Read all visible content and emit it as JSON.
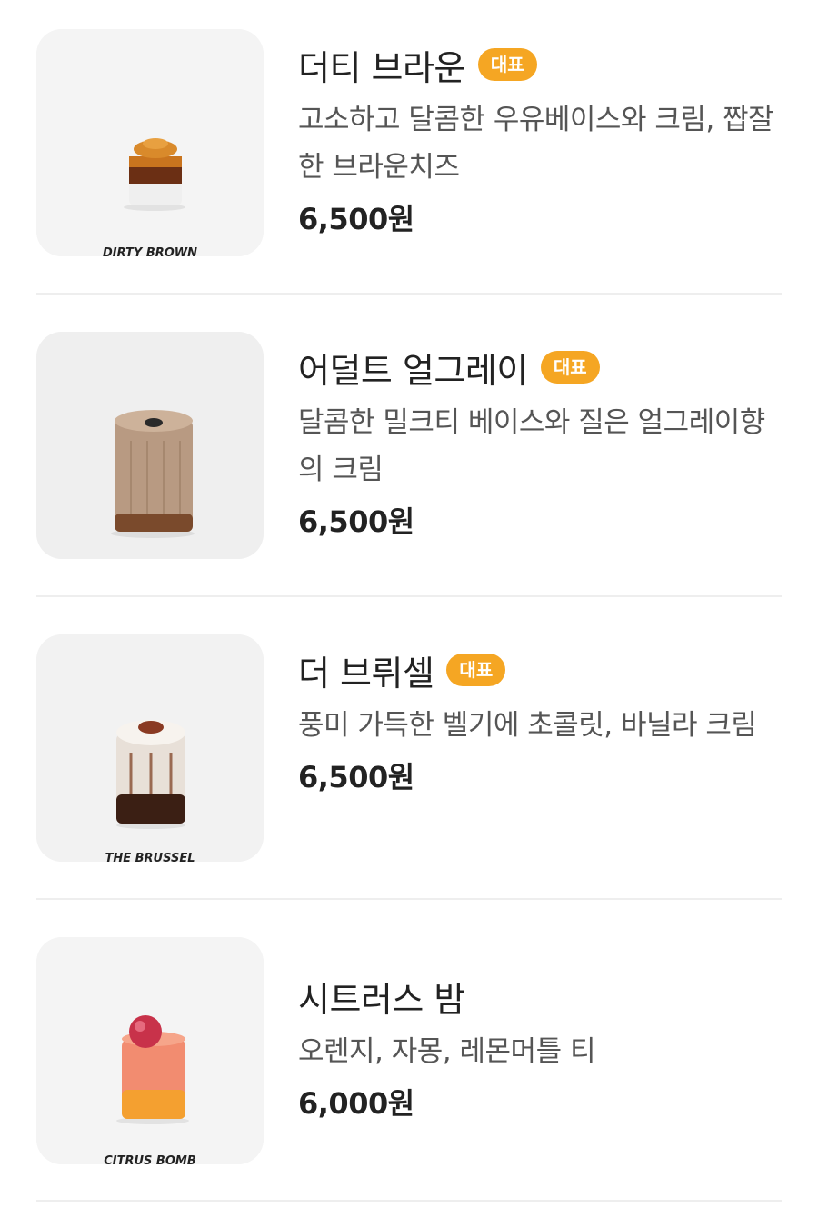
{
  "colors": {
    "badge": "#f5a623",
    "divider": "#eeeeee"
  },
  "items": [
    {
      "name": "더티 브라운",
      "badge": "대표",
      "description": "고소하고 달콤한 우유베이스와 크림, 짭잘한 브라운치즈",
      "price": "6,500원",
      "photo_caption": "DIRTY BROWN"
    },
    {
      "name": "어덜트 얼그레이",
      "badge": "대표",
      "description": "달콤한 밀크티 베이스와 질은 얼그레이향의 크림",
      "price": "6,500원",
      "photo_caption": ""
    },
    {
      "name": "더 브뤼셀",
      "badge": "대표",
      "description": "풍미 가득한 벨기에 초콜릿, 바닐라 크림",
      "price": "6,500원",
      "photo_caption": "THE BRUSSEL"
    },
    {
      "name": "시트러스 밤",
      "badge": "",
      "description": "오렌지, 자몽, 레몬머틀 티",
      "price": "6,000원",
      "photo_caption": "CITRUS BOMB"
    }
  ]
}
